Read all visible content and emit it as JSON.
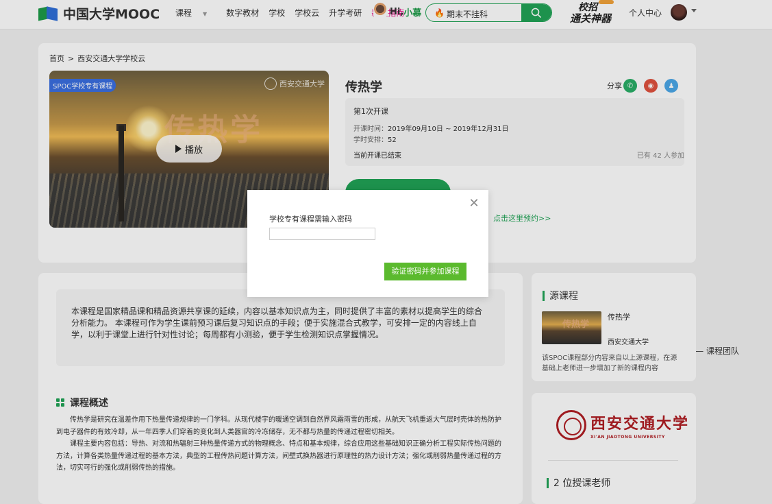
{
  "header": {
    "logo_text": "中国大学MOOC",
    "nav": [
      "课程",
      "数字教材",
      "学校",
      "学校云",
      "升学考研",
      "新生指南"
    ],
    "greeting_prefix": "Hi, ",
    "greeting_name": "小慕",
    "search_value": "期末不挂科",
    "promo_line1": "校招",
    "promo_line2": "通关神器",
    "user_center": "个人中心"
  },
  "breadcrumb": [
    "首页",
    "西安交通大学学校云"
  ],
  "video": {
    "tag": "SPOC学校专有课程",
    "play_label": "播放",
    "seal_text": "西安交通大学",
    "watermark": "传热学"
  },
  "course": {
    "title": "传热学",
    "share_label": "分享",
    "term": "第1次开课",
    "time_label": "开课时间：",
    "time_value": "2019年09月10日 ~ 2019年12月31日",
    "hours_label": "学时安排：",
    "hours_value": "52",
    "status": "当前开课已结束",
    "participants": "已有 42 人参加",
    "reserve_link": "点击这里预约>>"
  },
  "modal": {
    "label": "学校专有课程需输入密码",
    "input_value": "",
    "submit": "验证密码并参加课程"
  },
  "quote": {
    "text": "本课程是国家精品课和精品资源共享课的延续，内容以基本知识点为主，同时提供了丰富的素材以提高学生的综合分析能力。 本课程可作为学生课前预习课后复习知识点的手段；便于实施混合式教学，可安排一定的内容线上自学，以利于课堂上进行针对性讨论；每周都有小测验，便于学生检测知识点掌握情况。",
    "author": "—— 课程团队"
  },
  "overview": {
    "heading": "课程概述",
    "p1": "传热学是研究在温差作用下热量传递规律的一门学科。从现代楼宇的暖通空调到自然界风霜雨雪的形成，从航天飞机重返大气层时壳体的热防护到电子器件的有效冷却，从一年四季人们穿着的变化到人类器官的冷冻储存，无不都与热量的传递过程密切相关。",
    "p2": "课程主要内容包括：导热、对流和热辐射三种热量传递方式的物理概念、特点和基本规律，综合应用这些基础知识正确分析工程实际传热问题的方法，计算各类热量传递过程的基本方法，典型的工程传热问题计算方法，间壁式换热器进行原理性的热力设计方法；强化或削弱热量传递过程的方法，切实可行的强化或削弱传热的措施。"
  },
  "source": {
    "heading": "源课程",
    "name": "传热学",
    "school": "西安交通大学",
    "thumb_text": "传热学",
    "note": "该SPOC课程部分内容来自以上源课程，在源基础上老师进一步增加了新的课程内容"
  },
  "school_card": {
    "name_cn": "西安交通大学",
    "name_en": "XI'AN JIAOTONG UNIVERSITY",
    "teachers_heading": "2 位授课老师"
  }
}
